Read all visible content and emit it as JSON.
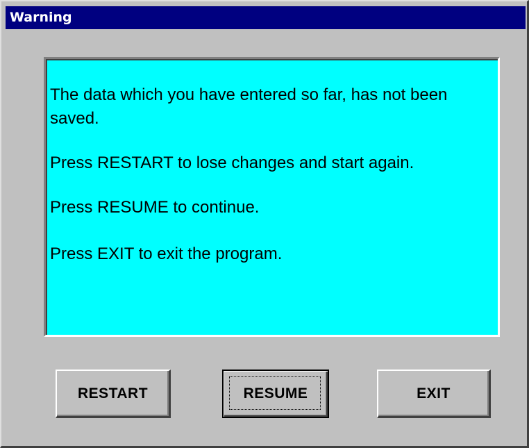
{
  "window": {
    "title": "Warning"
  },
  "message": {
    "line1": "The data which you have entered so far, has not been saved.",
    "line2": "Press RESTART to lose changes and start again.",
    "line3": "Press RESUME to continue.",
    "line4": "Press EXIT to exit the program."
  },
  "buttons": {
    "restart": "RESTART",
    "resume": "RESUME",
    "exit": "EXIT"
  },
  "colors": {
    "titlebar": "#000080",
    "panel": "#00ffff",
    "face": "#c0c0c0"
  }
}
